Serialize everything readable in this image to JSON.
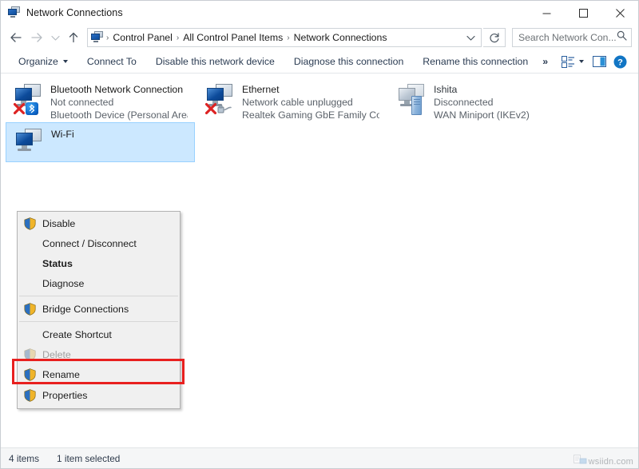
{
  "window": {
    "title": "Network Connections",
    "icon": "network-connections-icon",
    "controls": {
      "minimize": "minimize-button",
      "maximize": "maximize-button",
      "close": "close-button"
    }
  },
  "navigation": {
    "back": "back-arrow-icon",
    "forward": "forward-arrow-icon",
    "recent": "recent-locations-chevron-icon",
    "up": "up-arrow-icon",
    "breadcrumb": {
      "icon": "control-panel-icon",
      "items": [
        "Control Panel",
        "All Control Panel Items",
        "Network Connections"
      ],
      "separator": "›",
      "dropdown": "breadcrumb-dropdown-icon"
    },
    "refresh": "refresh-icon",
    "search": {
      "placeholder": "Search Network Con...",
      "icon": "search-icon"
    }
  },
  "toolbar": {
    "items": [
      {
        "label": "Organize",
        "has_caret": true
      },
      {
        "label": "Connect To",
        "has_caret": false
      },
      {
        "label": "Disable this network device",
        "has_caret": false
      },
      {
        "label": "Diagnose this connection",
        "has_caret": false
      },
      {
        "label": "Rename this connection",
        "has_caret": false
      }
    ],
    "overflow": "»",
    "view_icon": "change-view-icon",
    "view_caret": "view-dropdown-caret",
    "preview_pane_icon": "preview-pane-icon",
    "help_icon": "help-icon"
  },
  "connections": [
    {
      "name": "Bluetooth Network Connection",
      "status": "Not connected",
      "device": "Bluetooth Device (Personal Area ...",
      "icon": "network-adapter-icon",
      "overlay": "red-x-icon",
      "badge": "bluetooth-badge-icon",
      "selected": false,
      "enabled": true
    },
    {
      "name": "Ethernet",
      "status": "Network cable unplugged",
      "device": "Realtek Gaming GbE Family Contr...",
      "icon": "network-adapter-icon",
      "overlay": "red-x-icon",
      "badge": "network-cable-badge-icon",
      "selected": false,
      "enabled": true
    },
    {
      "name": "Ishita",
      "status": "Disconnected",
      "device": "WAN Miniport (IKEv2)",
      "icon": "network-adapter-icon",
      "overlay": "",
      "badge": "vpn-tower-badge-icon",
      "selected": false,
      "enabled": false
    },
    {
      "name": "Wi-Fi",
      "status": "",
      "device": "",
      "icon": "wireless-adapter-icon",
      "overlay": "",
      "badge": "",
      "selected": true,
      "enabled": true
    }
  ],
  "context_menu": {
    "items": [
      {
        "label": "Disable",
        "shield": true,
        "bold": false,
        "disabled": false,
        "separator_after": false
      },
      {
        "label": "Connect / Disconnect",
        "shield": false,
        "bold": false,
        "disabled": false,
        "separator_after": false
      },
      {
        "label": "Status",
        "shield": false,
        "bold": true,
        "disabled": false,
        "separator_after": false
      },
      {
        "label": "Diagnose",
        "shield": false,
        "bold": false,
        "disabled": false,
        "separator_after": true
      },
      {
        "label": "Bridge Connections",
        "shield": true,
        "bold": false,
        "disabled": false,
        "separator_after": true
      },
      {
        "label": "Create Shortcut",
        "shield": false,
        "bold": false,
        "disabled": false,
        "separator_after": false
      },
      {
        "label": "Delete",
        "shield": true,
        "bold": false,
        "disabled": true,
        "separator_after": false
      },
      {
        "label": "Rename",
        "shield": true,
        "bold": false,
        "disabled": false,
        "separator_after": false
      },
      {
        "label": "Properties",
        "shield": true,
        "bold": false,
        "disabled": false,
        "separator_after": false
      }
    ],
    "highlighted_item": "Properties"
  },
  "annotation": {
    "color": "#e8201f",
    "target": "Properties"
  },
  "status_bar": {
    "item_count": "4 items",
    "selection": "1 item selected"
  },
  "watermark": {
    "text": "wsiidn.com"
  },
  "colors": {
    "selection_fill": "#cce8ff",
    "selection_border": "#99d1ff",
    "menu_background": "#f0f0f0",
    "toolbar_text": "#2a3b52",
    "annotation_red": "#e8201f"
  }
}
